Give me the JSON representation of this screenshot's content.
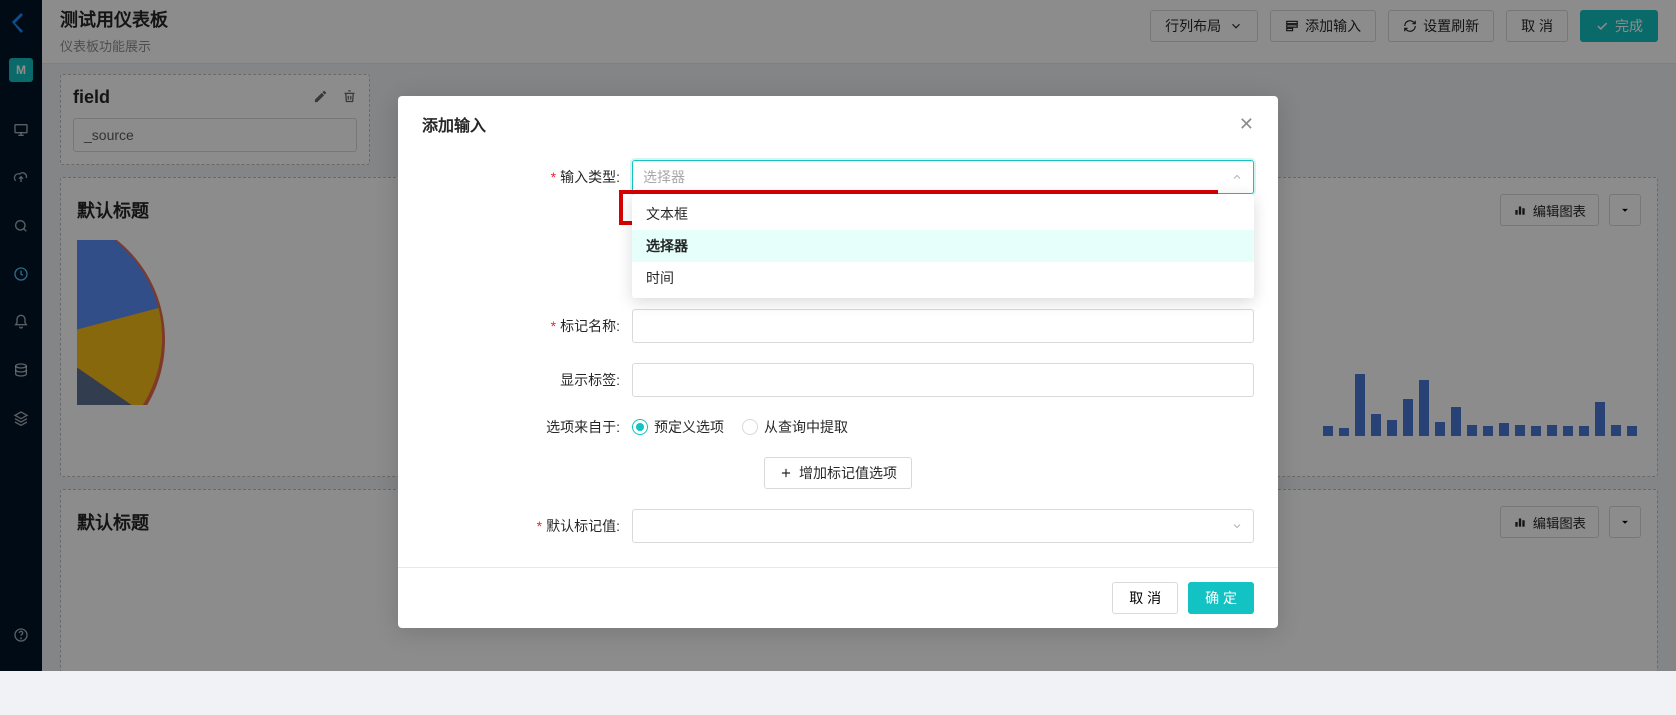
{
  "sidebar": {
    "avatar_letter": "M"
  },
  "topbar": {
    "title": "测试用仪表板",
    "subtitle": "仪表板功能展示",
    "buttons": {
      "layout": "行列布局",
      "add_input": "添加输入",
      "set_refresh": "设置刷新",
      "cancel": "取 消",
      "done": "完成"
    }
  },
  "field_panel": {
    "title": "field",
    "value": "_source"
  },
  "card1": {
    "title": "默认标题",
    "edit_chart": "编辑图表"
  },
  "card2": {
    "title": "默认标题",
    "edit_chart": "编辑图表"
  },
  "modal": {
    "title": "添加输入",
    "labels": {
      "input_type": "输入类型:",
      "marker_name": "标记名称:",
      "display_label": "显示标签:",
      "options_from": "选项来自于:",
      "default_value": "默认标记值:"
    },
    "placeholders": {
      "input_type": "选择器"
    },
    "dropdown_options": [
      "文本框",
      "选择器",
      "时间"
    ],
    "dropdown_highlighted_index": 1,
    "radio": {
      "predefined": "预定义选项",
      "from_query": "从查询中提取"
    },
    "add_option": "增加标记值选项",
    "cancel": "取 消",
    "ok": "确 定"
  }
}
